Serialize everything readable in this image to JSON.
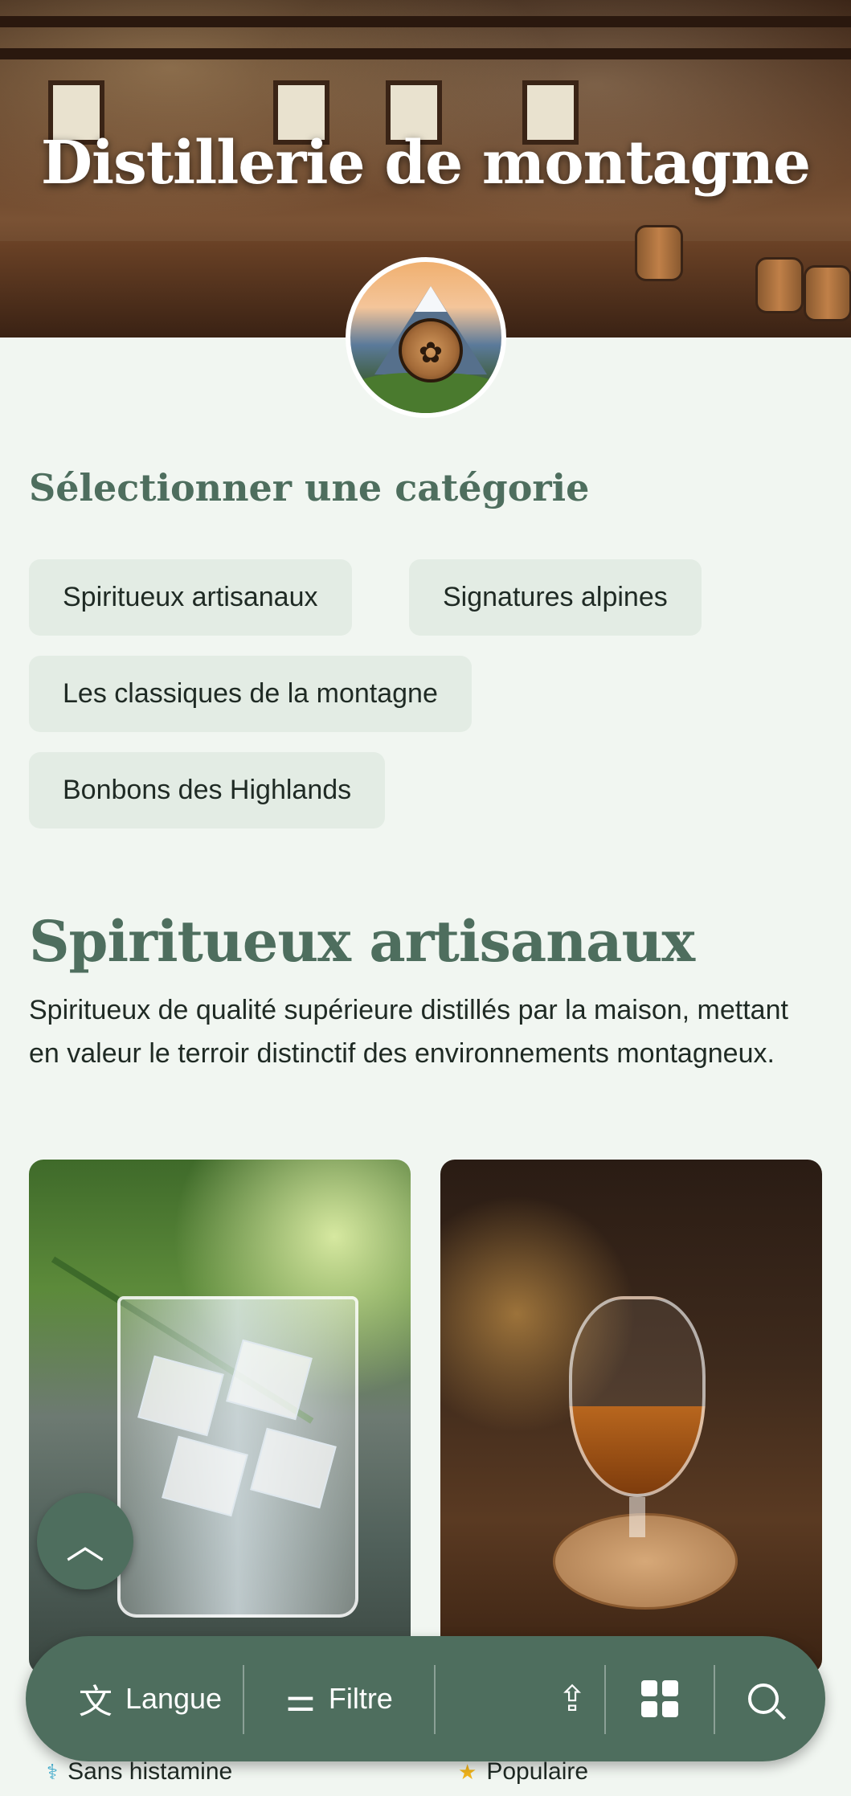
{
  "hero": {
    "title": "Distillerie de montagne",
    "logo_icon": "mountain-barrel-logo"
  },
  "categories": {
    "heading": "Sélectionner une catégorie",
    "items": [
      "Spiritueux artisanaux",
      "Signatures alpines",
      "Les classiques de la montagne",
      "Bonbons des Highlands"
    ]
  },
  "section": {
    "title": "Spiritueux artisanaux",
    "description": "Spiritueux de qualité supérieure distillés par la maison, mettant en valeur le terroir distinctif des environnements montagneux."
  },
  "products": [
    {
      "image": "gin-tonic-rosemary-photo",
      "tag_icon": "histamine-icon",
      "tag": "Sans histamine",
      "tag_color": "#3aa7c9"
    },
    {
      "image": "whisky-glass-photo",
      "tag_icon": "star-icon",
      "tag": "Populaire",
      "tag_color": "#f2b51c"
    }
  ],
  "toolbar": {
    "language_label": "Langue",
    "filter_label": "Filtre",
    "share_icon": "share-icon",
    "grid_icon": "grid-icon",
    "search_icon": "search-icon"
  },
  "colors": {
    "accent": "#4e6e5e",
    "background": "#f1f6f1",
    "chip": "#e3ece4"
  }
}
